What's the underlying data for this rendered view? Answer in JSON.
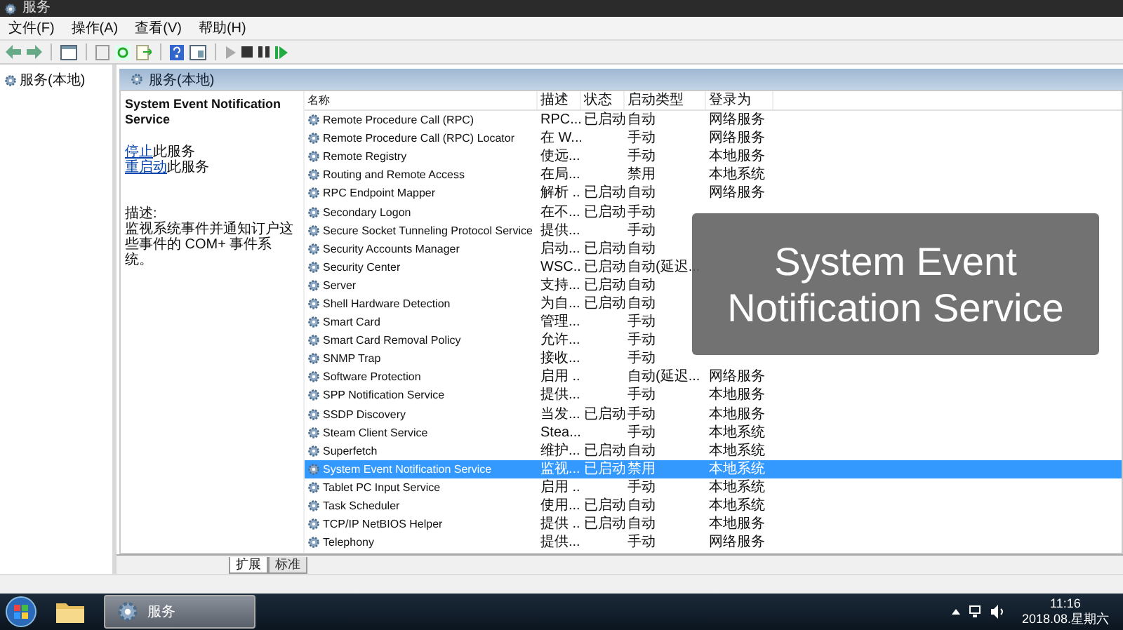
{
  "window": {
    "title": "服务"
  },
  "menu": [
    "文件(F)",
    "操作(A)",
    "查看(V)",
    "帮助(H)"
  ],
  "tree": {
    "items": [
      {
        "label": "服务(本地)",
        "selected": false
      }
    ]
  },
  "panel_header": "服务(本地)",
  "details": {
    "title": "System Event Notification Service",
    "actions": [
      {
        "link": "停止",
        "text": "此服务"
      },
      {
        "link": "重启动",
        "text": "此服务"
      }
    ],
    "description_label": "描述:",
    "description": "监视系统事件并通知订户这些事件的 COM+ 事件系统。"
  },
  "table": {
    "columns": [
      "名称",
      "描述",
      "状态",
      "启动类型",
      "登录为"
    ],
    "rows": [
      {
        "name": "Remote Procedure Call (RPC)",
        "description": "RPC...",
        "status": "已启动",
        "startup": "自动",
        "login": "网络服务",
        "selected": false
      },
      {
        "name": "Remote Procedure Call (RPC) Locator",
        "description": "在 W...",
        "startup": "手动",
        "login": "网络服务",
        "selected": false
      },
      {
        "name": "Remote Registry",
        "description": "使远...",
        "startup": "手动",
        "login": "本地服务",
        "selected": false
      },
      {
        "name": "Routing and Remote Access",
        "description": "在局...",
        "startup": "禁用",
        "login": "本地系统",
        "selected": false
      },
      {
        "name": "RPC Endpoint Mapper",
        "description": "解析 ...",
        "status": "已启动",
        "startup": "自动",
        "login": "网络服务",
        "selected": false
      },
      {
        "name": "Secondary Logon",
        "description": "在不...",
        "status": "已启动",
        "startup": "手动",
        "selected": false
      },
      {
        "name": "Secure Socket Tunneling Protocol Service",
        "description": "提供...",
        "startup": "手动",
        "selected": false
      },
      {
        "name": "Security Accounts Manager",
        "description": "启动...",
        "status": "已启动",
        "startup": "自动",
        "selected": false
      },
      {
        "name": "Security Center",
        "description": "WSC...",
        "status": "已启动",
        "startup": "自动(延迟...",
        "selected": false
      },
      {
        "name": "Server",
        "description": "支持...",
        "status": "已启动",
        "startup": "自动",
        "selected": false
      },
      {
        "name": "Shell Hardware Detection",
        "description": "为自...",
        "status": "已启动",
        "startup": "自动",
        "selected": false
      },
      {
        "name": "Smart Card",
        "description": "管理...",
        "startup": "手动",
        "selected": false
      },
      {
        "name": "Smart Card Removal Policy",
        "description": "允许...",
        "startup": "手动",
        "selected": false
      },
      {
        "name": "SNMP Trap",
        "description": "接收...",
        "startup": "手动",
        "selected": false
      },
      {
        "name": "Software Protection",
        "description": "启用 ...",
        "startup": "自动(延迟...",
        "login": "网络服务",
        "selected": false
      },
      {
        "name": "SPP Notification Service",
        "description": "提供...",
        "startup": "手动",
        "login": "本地服务",
        "selected": false
      },
      {
        "name": "SSDP Discovery",
        "description": "当发...",
        "status": "已启动",
        "startup": "手动",
        "login": "本地服务",
        "selected": false
      },
      {
        "name": "Steam Client Service",
        "description": "Stea...",
        "startup": "手动",
        "login": "本地系统",
        "selected": false
      },
      {
        "name": "Superfetch",
        "description": "维护...",
        "status": "已启动",
        "startup": "自动",
        "login": "本地系统",
        "selected": false
      },
      {
        "name": "System Event Notification Service",
        "description": "监视...",
        "status": "已启动",
        "startup": "禁用",
        "login": "本地系统",
        "selected": true
      },
      {
        "name": "Tablet PC Input Service",
        "description": "启用 ...",
        "startup": "手动",
        "login": "本地系统",
        "selected": false
      },
      {
        "name": "Task Scheduler",
        "description": "使用...",
        "status": "已启动",
        "startup": "自动",
        "login": "本地系统",
        "selected": false
      },
      {
        "name": "TCP/IP NetBIOS Helper",
        "description": "提供 ...",
        "status": "已启动",
        "startup": "自动",
        "login": "本地服务",
        "selected": false
      },
      {
        "name": "Telephony",
        "description": "提供...",
        "startup": "手动",
        "login": "网络服务",
        "selected": false
      }
    ]
  },
  "view_tabs": [
    {
      "label": "扩展",
      "selected": true
    },
    {
      "label": "标准",
      "selected": false
    }
  ],
  "caption": "System Event Notification Service",
  "taskbar": {
    "tasks": [
      {
        "kind": "folder",
        "selected": false
      },
      {
        "kind": "gear",
        "label": "服务",
        "selected": true
      }
    ],
    "time": "11:16",
    "date": "2018.08.星期六"
  }
}
